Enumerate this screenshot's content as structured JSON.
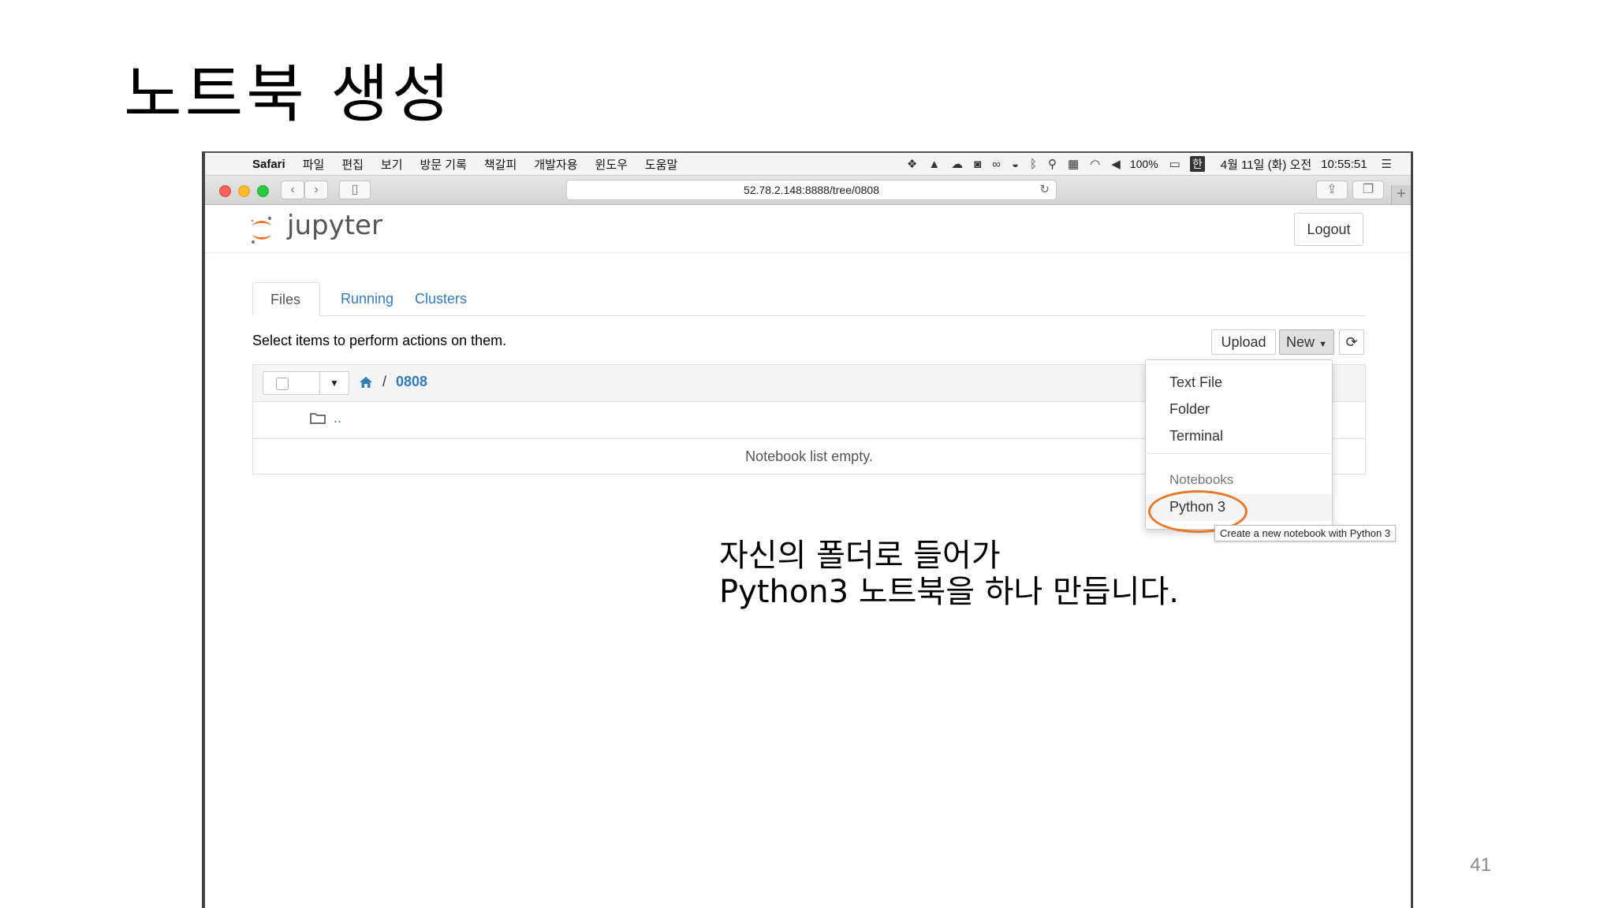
{
  "slide": {
    "title": "노트북 생성",
    "page_number": "41",
    "caption_line1": "자신의 폴더로 들어가",
    "caption_line2": "Python3 노트북을 하나 만듭니다."
  },
  "mac_menubar": {
    "app_name": "Safari",
    "items": [
      "파일",
      "편집",
      "보기",
      "방문 기록",
      "책갈피",
      "개발자용",
      "윈도우",
      "도움말"
    ],
    "battery": "100%",
    "input_method": "한",
    "date": "4월 11일 (화) 오전",
    "time": "10:55:51"
  },
  "browser": {
    "url": "52.78.2.148:8888/tree/0808"
  },
  "jupyter": {
    "wordmark": "jupyter",
    "logout_label": "Logout",
    "tabs": [
      "Files",
      "Running",
      "Clusters"
    ],
    "select_text": "Select items to perform actions on them.",
    "upload_label": "Upload",
    "new_label": "New",
    "breadcrumb_current": "0808",
    "breadcrumb_separator": "/",
    "parent_dir": "..",
    "empty_message": "Notebook list empty.",
    "new_menu": {
      "items": [
        "Text File",
        "Folder",
        "Terminal"
      ],
      "section_header": "Notebooks",
      "notebook_item": "Python 3"
    },
    "tooltip": "Create a new notebook with Python 3"
  },
  "colors": {
    "jupyter_orange": "#e8782a",
    "link_blue": "#337ab7",
    "highlight": "#e8782a"
  }
}
